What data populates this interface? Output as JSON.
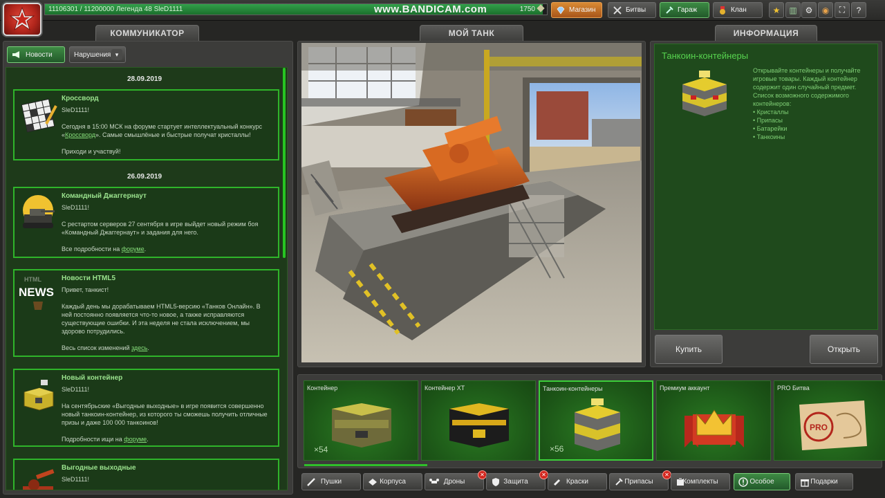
{
  "top": {
    "xp_text": "11106301 / 11200000   Легенда 48 SleD1111",
    "xp_fraction": 0.9916,
    "watermark": "www.BANDICAM.com",
    "crystals": "1750",
    "nav": {
      "shop": "Магазин",
      "battles": "Битвы",
      "garage": "Гараж",
      "clan": "Клан"
    },
    "icons": [
      "star-icon",
      "missions-icon",
      "settings-icon",
      "sound-icon",
      "fullscreen-icon",
      "help-icon"
    ]
  },
  "communicator": {
    "tab": "КОММУНИКАТОР",
    "news_btn": "Новости",
    "violations_btn": "Нарушения",
    "dates": [
      "28.09.2019",
      "26.09.2019"
    ],
    "cards": [
      {
        "title": "Кроссворд",
        "body1": "SleD1111!",
        "body2a": "Сегодня в 15:00 МСК на форуме стартует интеллектуальный конкурс «",
        "body2link": "Кроссворд",
        "body2b": "». Самые смышлёные и быстрые получат кристаллы!",
        "body3": "Приходи и участвуй!"
      },
      {
        "title": "Командный Джаггернаут",
        "body1": "SleD1111!",
        "body2": "С рестартом серверов 27 сентября в игре выйдет новый режим боя «Командный Джаггернаут» и задания для него.",
        "body3a": "Все подробности на ",
        "body3link": "форуме",
        "body3b": "."
      },
      {
        "title": "Новости HTML5",
        "body1": "Привет, танкист!",
        "body2": "Каждый день мы дорабатываем HTML5-версию «Танков Онлайн». В ней постоянно появляется что-то новое, а также исправляются существующие ошибки. И эта неделя не стала исключением, мы здорово потрудились.",
        "body3a": "Весь список изменений ",
        "body3link": "здесь",
        "body3b": ".",
        "thumb_small": "HTML",
        "thumb_big": "NEWS"
      },
      {
        "title": "Новый контейнер",
        "body1": "SleD1111!",
        "body2": "На сентябрьские «Выгодные выходные» в игре появится совершенно новый танкоин-контейнер, из которого ты сможешь получить отличные призы и даже 100 000 танкоинов!",
        "body3a": "Подробности ищи на ",
        "body3link": "форуме",
        "body3b": "."
      },
      {
        "title": "Выгодные выходные",
        "body1": "SleD1111!"
      }
    ]
  },
  "tank": {
    "tab": "МОЙ ТАНК"
  },
  "info": {
    "tab": "ИНФОРМАЦИЯ",
    "title": "Танкоин-контейнеры",
    "text": "Открывайте контейнеры и получайте игровые товары. Каждый контейнер содержит один случайный предмет. Список возможного содержимого контейнеров:",
    "list": [
      "• Кристаллы",
      "• Припасы",
      "• Батарейки",
      "• Танкоины"
    ],
    "buy": "Купить",
    "open": "Открыть"
  },
  "items": [
    {
      "name": "Контейнер",
      "count": "×54"
    },
    {
      "name": "Контейнер XT",
      "count": ""
    },
    {
      "name": "Танкоин-контейнеры",
      "count": "×56"
    },
    {
      "name": "Премиум аккаунт",
      "count": ""
    },
    {
      "name": "PRO Битва",
      "count": "",
      "stamp": "PRO"
    }
  ],
  "categories": [
    "Пушки",
    "Корпуса",
    "Дроны",
    "Защита",
    "Краски",
    "Припасы",
    "Комплекты",
    "Особое",
    "Подарки"
  ],
  "colors": {
    "accent_green": "#2fb52a",
    "panel": "#3c3c3a",
    "shop_orange": "#d98a34",
    "badge_red": "#d3271f"
  }
}
